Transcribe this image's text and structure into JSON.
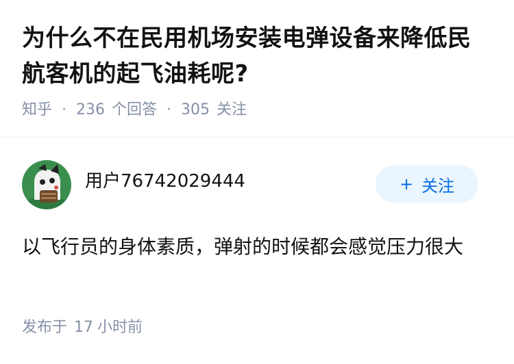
{
  "question": {
    "title": "为什么不在民用机场安装电弹设备来降低民航客机的起飞油耗呢?",
    "source": "知乎",
    "separator": "·",
    "answer_count": "236",
    "answer_label": "个回答",
    "follower_count": "305",
    "follower_label": "关注"
  },
  "answer": {
    "author_name": "用户76742029444",
    "follow_button": {
      "icon": "+",
      "label": "关注"
    },
    "text": "以飞行员的身体素质，弹射的时候都会感觉压力很大",
    "publish": {
      "prefix": "发布于",
      "time_value": "17",
      "time_unit": "小时前"
    }
  },
  "colors": {
    "title": "#121212",
    "meta": "#8590a6",
    "accent": "#056de8",
    "button_bg": "#ebf5fd",
    "divider": "#ececec",
    "avatar_bg": "#3a8f4f"
  }
}
